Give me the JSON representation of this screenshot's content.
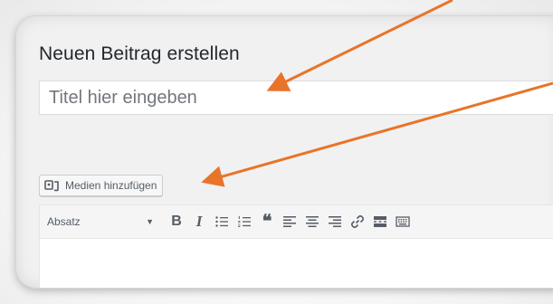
{
  "page": {
    "title": "Neuen Beitrag erstellen"
  },
  "title_field": {
    "placeholder": "Titel hier eingeben"
  },
  "media_button": {
    "label": "Medien hinzufügen",
    "icon": "media-icon"
  },
  "editor_toolbar": {
    "format_select": "Absatz",
    "buttons": [
      "bold-icon",
      "italic-icon",
      "bullet-list-icon",
      "numbered-list-icon",
      "blockquote-icon",
      "align-left-icon",
      "align-center-icon",
      "align-right-icon",
      "link-icon",
      "read-more-icon",
      "toolbar-toggle-icon"
    ]
  },
  "annotations": {
    "arrow_color": "#e8742a"
  }
}
